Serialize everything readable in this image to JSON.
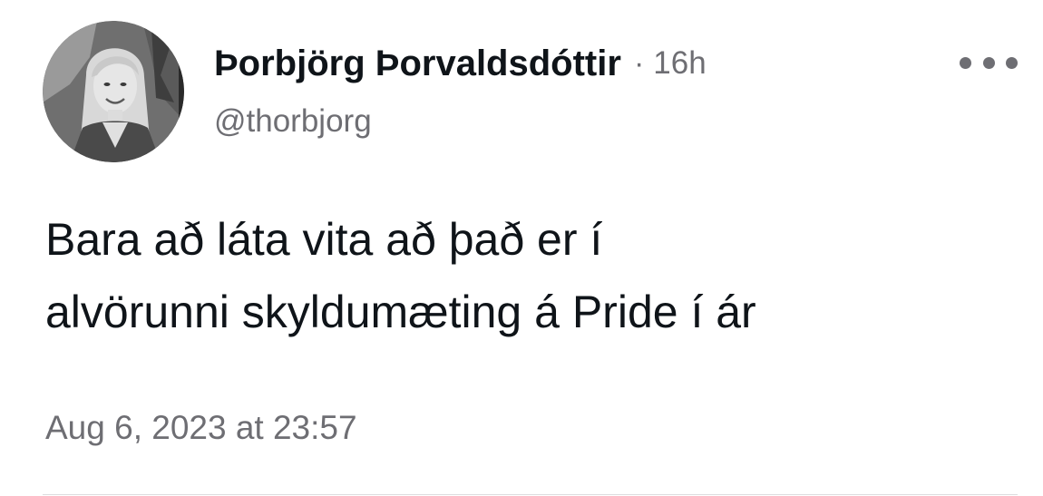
{
  "author": {
    "display_name": "Þorbjörg Þorvaldsdóttir",
    "handle": "@thorbjorg",
    "time_ago": "16h",
    "separator": "·"
  },
  "tweet": {
    "lines": [
      "Bara að láta vita að það er í",
      "alvörunni skyldumæting á Pride í ár"
    ],
    "timestamp": "Aug 6, 2023 at 23:57"
  },
  "icons": {
    "more": "more-horizontal-icon",
    "avatar": "profile-photo"
  },
  "colors": {
    "text": "#0f1419",
    "secondary": "#6e6e73",
    "divider": "#dcdcdf",
    "background": "#ffffff"
  }
}
